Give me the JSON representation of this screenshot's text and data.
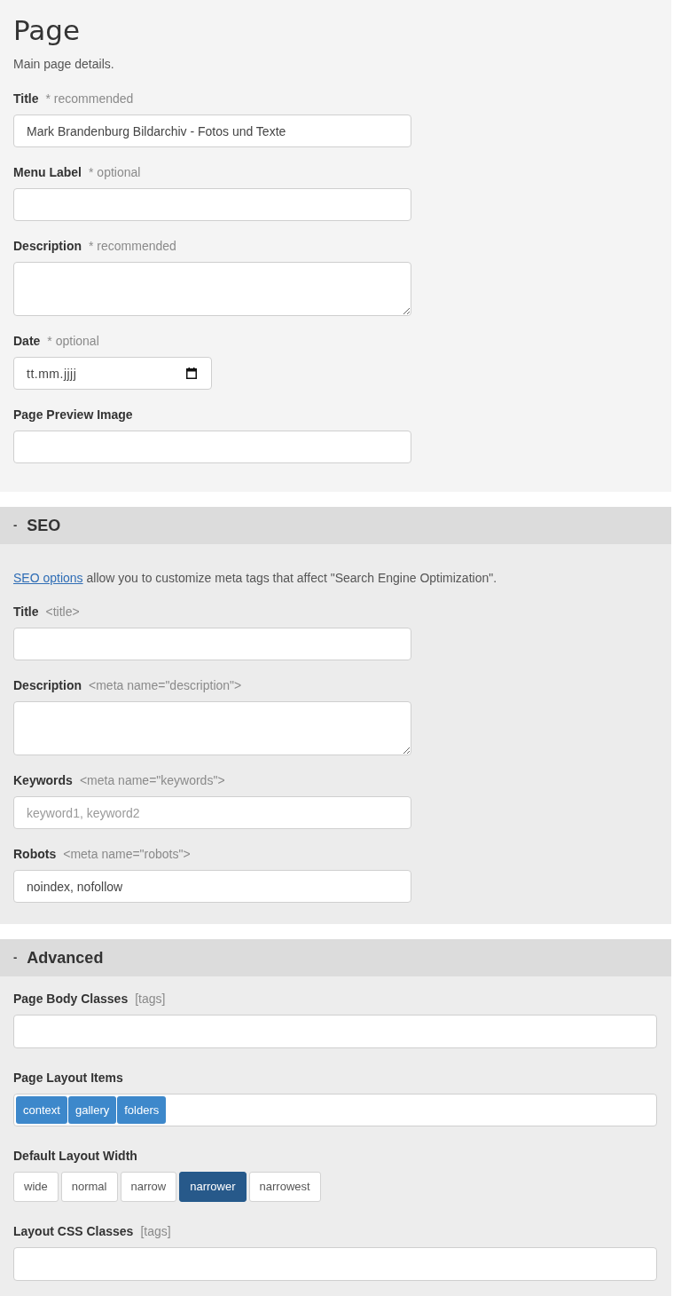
{
  "page": {
    "title": "Page",
    "subtitle": "Main page details.",
    "fields": [
      {
        "kind": "text",
        "label": "Title",
        "note": "* recommended",
        "value": "Mark Brandenburg Bildarchiv - Fotos und Texte"
      },
      {
        "kind": "text",
        "label": "Menu Label",
        "note": "* optional"
      },
      {
        "kind": "textarea",
        "label": "Description",
        "note": "* recommended"
      },
      {
        "kind": "date",
        "label": "Date",
        "note": "* optional",
        "placeholder": "tt.mm.jjjj"
      },
      {
        "kind": "text",
        "label": "Page Preview Image"
      }
    ]
  },
  "seo": {
    "toggle": "-",
    "title": "SEO",
    "intro": {
      "link": "SEO options",
      "text": "allow you to customize meta tags that affect \"Search Engine Optimization\"."
    },
    "fields": [
      {
        "kind": "text",
        "label": "Title",
        "note": "<title>"
      },
      {
        "kind": "textarea",
        "label": "Description",
        "note": "<meta name=\"description\">"
      },
      {
        "kind": "text",
        "label": "Keywords",
        "note": "<meta name=\"keywords\">",
        "placeholder": "keyword1, keyword2"
      },
      {
        "kind": "text",
        "label": "Robots",
        "note": "<meta name=\"robots\">",
        "value": "noindex, nofollow"
      }
    ]
  },
  "advanced": {
    "toggle": "-",
    "title": "Advanced",
    "fields": [
      {
        "kind": "wide_text",
        "label": "Page Body Classes",
        "note": "[tags]"
      },
      {
        "kind": "tags",
        "label": "Page Layout Items",
        "tags": [
          "context",
          "gallery",
          "folders"
        ]
      },
      {
        "kind": "choice",
        "label": "Default Layout Width",
        "options": [
          {
            "label": "wide",
            "selected": false
          },
          {
            "label": "normal",
            "selected": false
          },
          {
            "label": "narrow",
            "selected": false
          },
          {
            "label": "narrower",
            "selected": true
          },
          {
            "label": "narrowest",
            "selected": false
          }
        ]
      },
      {
        "kind": "wide_text",
        "label": "Layout CSS Classes",
        "note": "[tags]"
      }
    ]
  }
}
